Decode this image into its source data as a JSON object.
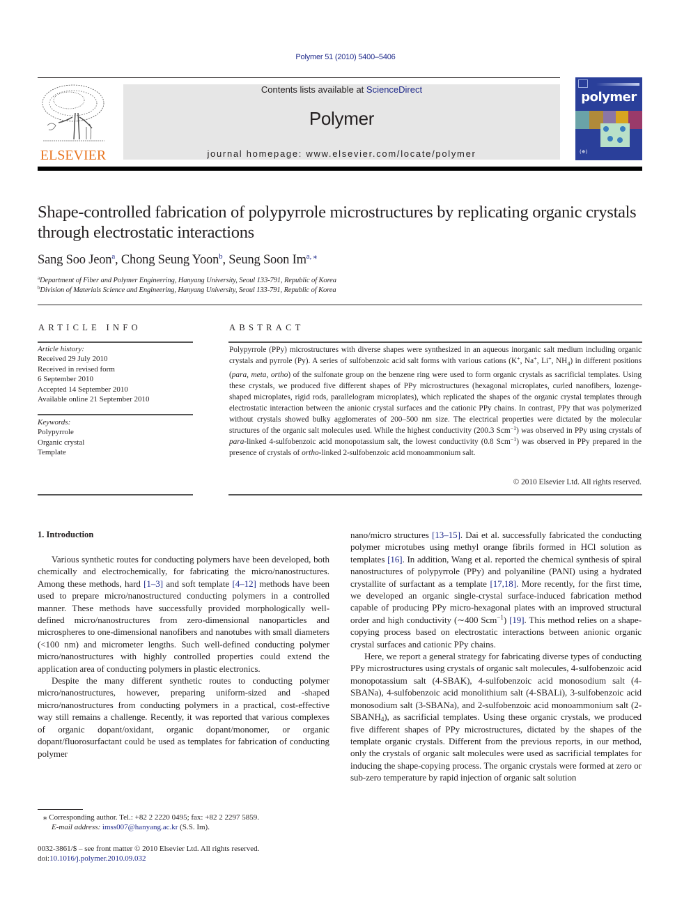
{
  "header": {
    "citation": "Polymer 51 (2010) 5400–5406",
    "contents_prefix": "Contents lists available at ",
    "contents_link": "ScienceDirect",
    "journal_name": "Polymer",
    "homepage": "journal homepage: www.elsevier.com/locate/polymer",
    "publisher_logo_text": "ELSEVIER",
    "cover_title": "polymer",
    "cover_badge": "(✵)"
  },
  "colors": {
    "link": "#1f2a8a",
    "elsevier_orange": "#e8731c",
    "cover_blue": "#2a3f9a",
    "masthead_grey": "#e6e6e6"
  },
  "article": {
    "title": "Shape-controlled fabrication of polypyrrole microstructures by replicating organic crystals through electrostatic interactions",
    "authors": [
      {
        "name": "Sang Soo Jeon",
        "affil": "a"
      },
      {
        "name": "Chong Seung Yoon",
        "affil": "b"
      },
      {
        "name": "Seung Soon Im",
        "affil": "a, ⁎"
      }
    ],
    "affiliations": [
      {
        "key": "a",
        "text": "Department of Fiber and Polymer Engineering, Hanyang University, Seoul 133-791, Republic of Korea"
      },
      {
        "key": "b",
        "text": "Division of Materials Science and Engineering, Hanyang University, Seoul 133-791, Republic of Korea"
      }
    ]
  },
  "article_info": {
    "heading": "ARTICLE INFO",
    "history_label": "Article history:",
    "history": [
      "Received 29 July 2010",
      "Received in revised form",
      "6 September 2010",
      "Accepted 14 September 2010",
      "Available online 21 September 2010"
    ],
    "keywords_label": "Keywords:",
    "keywords": [
      "Polypyrrole",
      "Organic crystal",
      "Template"
    ]
  },
  "abstract": {
    "heading": "ABSTRACT",
    "s1": "Polypyrrole (PPy) microstructures with diverse shapes were synthesized in an aqueous inorganic salt medium including organic crystals and pyrrole (Py). A series of sulfobenzoic acid salt forms with various cations (K",
    "s2": ", Na",
    "s3": ", Li",
    "s4": ", NH",
    "s5": ") in different positions (",
    "para": "para",
    "sep1": ", ",
    "meta": "meta",
    "sep2": ", ",
    "ortho": "ortho",
    "s6": ") of the sulfonate group on the benzene ring were used to form organic crystals as sacrificial templates. Using these crystals, we produced five different shapes of PPy microstructures (hexagonal microplates, curled nanofibers, lozenge-shaped microplates, rigid rods, parallelogram microplates), which replicated the shapes of the organic crystal templates through electrostatic interaction between the anionic crystal surfaces and the cationic PPy chains. In contrast, PPy that was polymerized without crystals showed bulky agglomerates of 200–500 nm size. The electrical properties were dictated by the molecular structures of the organic salt molecules used. While the highest conductivity (200.3 Scm",
    "s7": ") was observed in PPy using crystals of ",
    "para2": "para",
    "s8": "-linked 4-sulfobenzoic acid monopotassium salt, the lowest conductivity (0.8 Scm",
    "s9": ") was observed in PPy prepared in the presence of crystals of ",
    "ortho2": "ortho",
    "s10": "-linked 2-sulfobenzoic acid monoammonium salt.",
    "plus": "+",
    "minus1": "−1",
    "nh4_sub": "4",
    "copyright": "© 2010 Elsevier Ltd. All rights reserved."
  },
  "intro": {
    "heading": "1.  Introduction",
    "p1_a": "Various synthetic routes for conducting polymers have been developed, both chemically and electrochemically, for fabricating the micro/nanostructures. Among these methods, hard ",
    "ref_1_3": "[1–3]",
    "p1_b": " and soft template ",
    "ref_4_12": "[4–12]",
    "p1_c": " methods have been used to prepare micro/nanostructured conducting polymers in a controlled manner. These methods have successfully provided morphologically well-defined micro/nanostructures from zero-dimensional nanoparticles and microspheres to one-dimensional nanofibers and nanotubes with small diameters (<100 nm) and micrometer lengths. Such well-defined conducting polymer micro/nanostructures with highly controlled properties could extend the application area of conducting polymers in plastic electronics.",
    "p2": "Despite the many different synthetic routes to conducting polymer micro/nanostructures, however, preparing uniform-sized and -shaped micro/nanostructures from conducting polymers in a practical, cost-effective way still remains a challenge. Recently, it was reported that various complexes of organic dopant/oxidant, organic dopant/monomer, or organic dopant/fluorosurfactant could be used as templates for fabrication of conducting polymer",
    "r1_a": "nano/micro structures ",
    "ref_13_15": "[13–15]",
    "r1_b": ". Dai et al. successfully fabricated the conducting polymer microtubes using methyl orange fibrils formed in HCl solution as templates ",
    "ref_16": "[16]",
    "r1_c": ". In addition, Wang et al. reported the chemical synthesis of spiral nanostructures of polypyrrole (PPy) and polyaniline (PANI) using a hydrated crystallite of surfactant as a template ",
    "ref_17_18": "[17,18]",
    "r1_d": ". More recently, for the first time, we developed an organic single-crystal surface-induced fabrication method capable of producing PPy micro-hexagonal plates with an improved structural order and high conductivity (∼400 Scm",
    "r1_sup": "−1",
    "r1_e": ") ",
    "ref_19": "[19]",
    "r1_f": ". This method relies on a shape-copying process based on electrostatic interactions between anionic organic crystal surfaces and cationic PPy chains.",
    "r2_a": "Here, we report a general strategy for fabricating diverse types of conducting PPy microstructures using crystals of organic salt molecules, 4-sulfobenzoic acid monopotassium salt (4-SBAK), 4-sulfobenzoic acid monosodium salt (4-SBANa), 4-sulfobenzoic acid monolithium salt (4-SBALi), 3-sulfobenzoic acid monosodium salt (3-SBANa), and 2-sulfobenzoic acid monoammonium salt (2-SBANH",
    "r2_sub": "4",
    "r2_b": "), as sacrificial templates. Using these organic crystals, we produced five different shapes of PPy microstructures, dictated by the shapes of the template organic crystals. Different from the previous reports, in our method, only the crystals of organic salt molecules were used as sacrificial templates for inducing the shape-copying process. The organic crystals were formed at zero or sub-zero temperature by rapid injection of organic salt solution"
  },
  "footnotes": {
    "corr": "⁎  Corresponding author. Tel.: +82 2 2220 0495; fax: +82 2 2297 5859.",
    "email_label": "E-mail address:",
    "email": "imss007@hanyang.ac.kr",
    "email_suffix": " (S.S. Im).",
    "front_matter": "0032-3861/$ – see front matter © 2010 Elsevier Ltd. All rights reserved.",
    "doi_label": "doi:",
    "doi": "10.1016/j.polymer.2010.09.032"
  }
}
